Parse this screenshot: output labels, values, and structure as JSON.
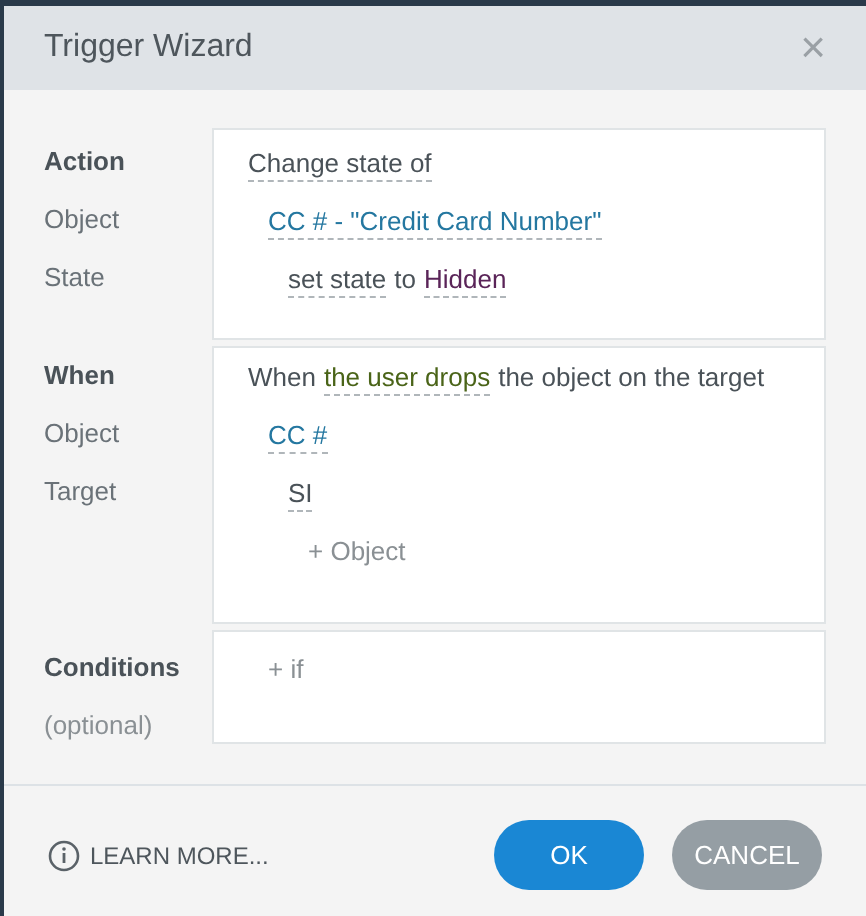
{
  "dialog": {
    "title": "Trigger Wizard",
    "close": "×"
  },
  "sections": [
    {
      "labels": [
        {
          "text": "Action",
          "kind": "heading"
        },
        {
          "text": "Object",
          "kind": "field"
        },
        {
          "text": "State",
          "kind": "field"
        }
      ],
      "lines": [
        {
          "kind": "statement",
          "segments": [
            {
              "text": "Change state of",
              "kind": "action"
            }
          ]
        },
        {
          "kind": "object",
          "segments": [
            {
              "text": "CC # - \"Credit Card Number\"",
              "kind": "object"
            }
          ]
        },
        {
          "kind": "detail",
          "segments": [
            {
              "text": "set state",
              "kind": "action"
            },
            {
              "text": "to",
              "kind": "plain"
            },
            {
              "text": "Hidden",
              "kind": "state"
            }
          ]
        }
      ]
    },
    {
      "labels": [
        {
          "text": "When",
          "kind": "heading"
        },
        {
          "text": "Object",
          "kind": "field"
        },
        {
          "text": "Target",
          "kind": "field"
        }
      ],
      "lines": [
        {
          "kind": "statement",
          "segments": [
            {
              "text": "When",
              "kind": "plain"
            },
            {
              "text": "the user drops",
              "kind": "event"
            },
            {
              "text": "the object on the target",
              "kind": "plain"
            }
          ]
        },
        {
          "kind": "object",
          "segments": [
            {
              "text": "CC #",
              "kind": "object"
            }
          ]
        },
        {
          "kind": "detail",
          "segments": [
            {
              "text": "SI",
              "kind": "action"
            }
          ]
        },
        {
          "kind": "add",
          "segments": [
            {
              "text": "+ Object",
              "kind": "add"
            }
          ]
        }
      ]
    },
    {
      "labels": [
        {
          "text": "Conditions",
          "kind": "heading"
        },
        {
          "text": "(optional)",
          "kind": "hint"
        }
      ],
      "lines": [
        {
          "kind": "object",
          "segments": [
            {
              "text": "+ if",
              "kind": "add"
            }
          ]
        }
      ]
    }
  ],
  "footer": {
    "learn_more": "LEARN MORE...",
    "ok": "OK",
    "cancel": "CANCEL"
  }
}
